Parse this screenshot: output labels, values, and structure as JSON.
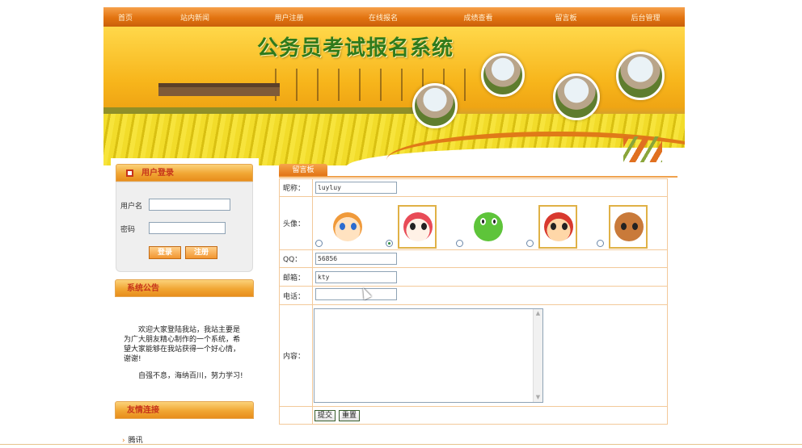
{
  "nav": {
    "items": [
      "首页",
      "站内新闻",
      "用户注册",
      "在线报名",
      "成绩查看",
      "留言板",
      "后台管理"
    ]
  },
  "banner": {
    "title": "公务员考试报名系统"
  },
  "login": {
    "title": "用户登录",
    "username_label": "用户名",
    "password_label": "密码",
    "username_value": "",
    "password_value": "",
    "login_button": "登录",
    "register_button": "注册"
  },
  "notice": {
    "title": "系统公告",
    "paragraph1": "欢迎大家登陆我站，我站主要是为广大朋友精心制作的一个系统，希望大家能够在我站获得一个好心情，谢谢!",
    "paragraph2": "自强不息，海纳百川，努力学习!"
  },
  "links": {
    "title": "友情连接",
    "items": [
      "腾讯"
    ]
  },
  "guestbook": {
    "tab_label": "留言板",
    "fields": {
      "nickname_label": "昵称：",
      "nickname_value": "luyluy",
      "avatar_label": "头像：",
      "qq_label": "QQ：",
      "qq_value": "56856",
      "email_label": "邮箱：",
      "email_value": "kty",
      "phone_label": "电话：",
      "phone_value": "",
      "content_label": "内容：",
      "content_value": ""
    },
    "avatars": [
      {
        "name": "anime-girl-avatar",
        "selected": false,
        "color": "#f5b35a"
      },
      {
        "name": "red-hood-girl-avatar",
        "selected": true,
        "color": "#e84b57"
      },
      {
        "name": "frog-avatar",
        "selected": false,
        "color": "#5ec43a"
      },
      {
        "name": "cartoon-kid-avatar",
        "selected": false,
        "color": "#f5c65a"
      },
      {
        "name": "bear-avatar",
        "selected": false,
        "color": "#c97a3a"
      }
    ],
    "submit_button": "提交",
    "reset_button": "重置"
  },
  "colors": {
    "nav_orange": "#e27310",
    "title_green": "#2f7a1c",
    "heading_red": "#c6331a",
    "border_light": "#f3c99a"
  }
}
